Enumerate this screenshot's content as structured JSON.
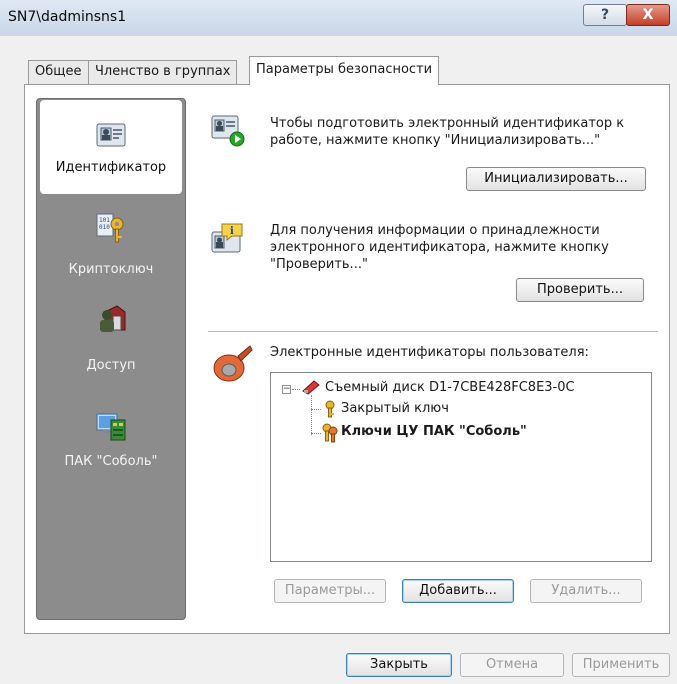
{
  "window": {
    "title": "SN7\\dadminsns1",
    "help_label": "?",
    "close_label": "X"
  },
  "tabs": [
    {
      "label": "Общее"
    },
    {
      "label": "Членство в группах"
    },
    {
      "label": "Параметры безопасности"
    }
  ],
  "sidebar": {
    "items": [
      {
        "label": "Идентификатор",
        "icon": "id-card-icon"
      },
      {
        "label": "Криптоключ",
        "icon": "crypto-key-icon"
      },
      {
        "label": "Доступ",
        "icon": "access-user-icon"
      },
      {
        "label": "ПАК \"Соболь\"",
        "icon": "sobol-board-icon"
      }
    ]
  },
  "init_section": {
    "text": "Чтобы подготовить электронный идентификатор к работе, нажмите кнопку \"Инициализировать...\"",
    "button": "Инициализировать..."
  },
  "check_section": {
    "text": "Для получения информации о принадлежности электронного идентификатора, нажмите кнопку \"Проверить...\"",
    "button": "Проверить..."
  },
  "ids_section": {
    "label": "Электронные идентификаторы пользователя:",
    "tree": {
      "root": "Съемный диск D1-7CBE428FC8E3-0C",
      "expander": "−",
      "children": [
        "Закрытый ключ",
        "Ключи ЦУ ПАК \"Соболь\""
      ]
    },
    "buttons": {
      "params": "Параметры...",
      "add": "Добавить...",
      "delete": "Удалить..."
    }
  },
  "footer": {
    "close": "Закрыть",
    "cancel": "Отмена",
    "apply": "Применить"
  },
  "colors": {
    "sidebar_bg": "#8c8c8c",
    "focus_border": "#3c7fb1"
  }
}
